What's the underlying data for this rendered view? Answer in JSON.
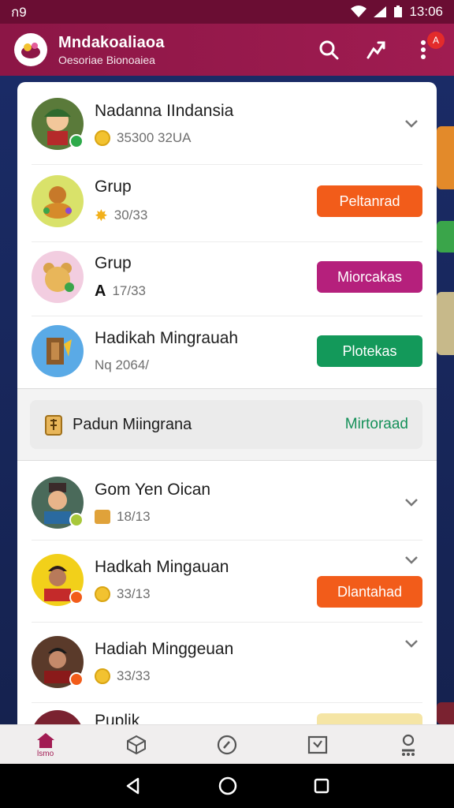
{
  "status_bar": {
    "time": "ก9",
    "clock": "13:06"
  },
  "header": {
    "title": "Mndakoaliaoa",
    "subtitle": "Oesoriae Bionoaiea",
    "notification_count": "A"
  },
  "colors": {
    "header": "#9a1a4f",
    "orange": "#f25c1a",
    "magenta": "#b5207c",
    "green": "#13995a",
    "nav_active": "#a21c53"
  },
  "list": [
    {
      "name": "Nadanna IIndansia",
      "meta": "35300 32UA",
      "meta_icon": "coin-icon",
      "action": null,
      "chevron": true
    },
    {
      "name": "Grup",
      "meta": "30/33",
      "meta_icon": "star-icon",
      "action": "Peltanrad",
      "action_color": "orange",
      "chevron": false
    },
    {
      "name": "Grup",
      "meta": "17/33",
      "meta_icon": "a-glyph",
      "meta_glyph": "A",
      "action": "Miorcakas",
      "action_color": "magenta",
      "chevron": false
    },
    {
      "name": "Hadikah Mingrauah",
      "meta": "Nq 2064/",
      "meta_icon": null,
      "action": "Plotekas",
      "action_color": "green",
      "chevron": false
    },
    {
      "name": "Gom Yen Oican",
      "meta": "18/13",
      "meta_icon": "calendar-icon",
      "action": null,
      "chevron": true
    },
    {
      "name": "Hadkah Mingauan",
      "meta": "33/13",
      "meta_icon": "coin-icon",
      "action": "Dlantahad",
      "action_color": "orange",
      "chevron": true
    },
    {
      "name": "Hadiah Minggeuan",
      "meta": "33/33",
      "meta_icon": "star-icon",
      "action": null,
      "chevron": true
    },
    {
      "name": "Puplik",
      "meta": "",
      "meta_icon": null,
      "action": null,
      "chevron": false
    }
  ],
  "banner": {
    "label": "Padun Miingrana",
    "action": "Mirtoraad"
  },
  "bottom_nav": {
    "home_label": "lsmo"
  }
}
